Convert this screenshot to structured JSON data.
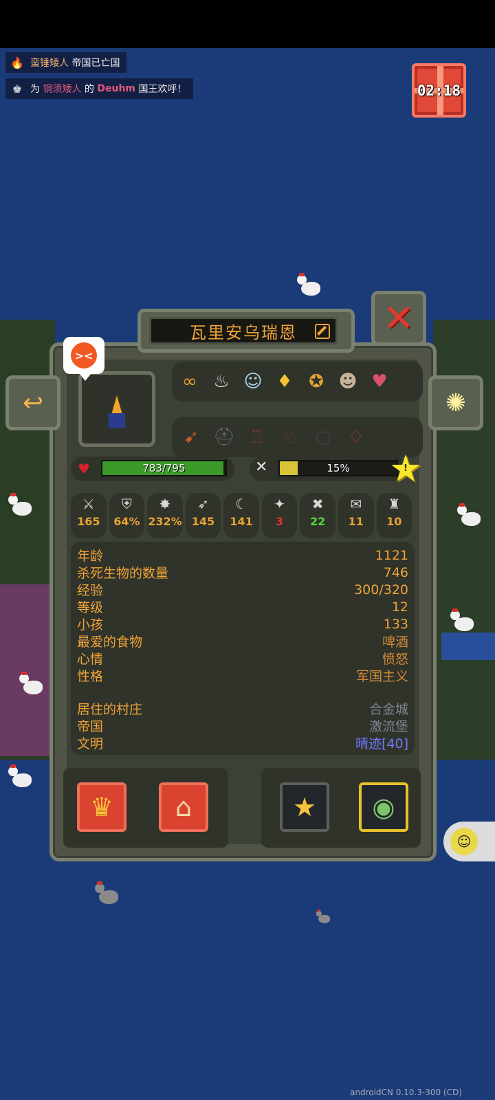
{
  "notifications": [
    {
      "icon": "fire-icon",
      "parts": [
        {
          "text": "蛮锤矮人",
          "style": "k"
        },
        {
          "text": " 帝国已亡国",
          "style": "w"
        }
      ]
    },
    {
      "icon": "king-icon",
      "parts": [
        {
          "text": "为 ",
          "style": "w"
        },
        {
          "text": "铜须矮人",
          "style": "r"
        },
        {
          "text": " 的 ",
          "style": "w"
        },
        {
          "text": "Deuhm",
          "style": "hl"
        },
        {
          "text": " 国王欢呼！",
          "style": "w"
        }
      ]
    }
  ],
  "gift_timer": "02:18",
  "unit": {
    "name": "瓦里安乌瑞恩",
    "mood_icon": "angry-face-icon",
    "traits": [
      "infinity-icon",
      "meat-icon",
      "ghost-icon",
      "golden-tooth-icon",
      "medal-icon",
      "hooded-figure-icon",
      "heart-mask-icon"
    ],
    "items": [
      "bow-icon",
      "helmet-icon",
      "armor-icon",
      "boots-icon",
      "ring-icon",
      "amulet-icon"
    ],
    "health": {
      "current": 783,
      "max": 795,
      "text": "783/795"
    },
    "hunger": {
      "percent": 15,
      "text": "15%"
    },
    "star_level": "!",
    "stats": [
      {
        "icon": "sword-icon",
        "glyph": "⚔",
        "value": "165",
        "color": "orange"
      },
      {
        "icon": "shield-icon",
        "glyph": "⛨",
        "value": "64%",
        "color": "orange"
      },
      {
        "icon": "crit-icon",
        "glyph": "✸",
        "value": "232%",
        "color": "orange"
      },
      {
        "icon": "speed-wing-icon",
        "glyph": "➶",
        "value": "145",
        "color": "orange"
      },
      {
        "icon": "scythe-icon",
        "glyph": "☾",
        "value": "141",
        "color": "orange"
      },
      {
        "icon": "range-icon",
        "glyph": "✦",
        "value": "3",
        "color": "red"
      },
      {
        "icon": "crossed-swords-icon",
        "glyph": "✖",
        "value": "22",
        "color": "green"
      },
      {
        "icon": "scroll-icon",
        "glyph": "✉",
        "value": "11",
        "color": "orange"
      },
      {
        "icon": "potion-icon",
        "glyph": "♜",
        "value": "10",
        "color": "orange"
      }
    ],
    "info": [
      {
        "label": "年龄",
        "value": "1121",
        "style": ""
      },
      {
        "label": "杀死生物的数量",
        "value": "746",
        "style": ""
      },
      {
        "label": "经验",
        "value": "300/320",
        "style": ""
      },
      {
        "label": "等级",
        "value": "12",
        "style": ""
      },
      {
        "label": "小孩",
        "value": "133",
        "style": ""
      },
      {
        "label": "最爱的食物",
        "value": "啤酒",
        "style": "food"
      },
      {
        "label": "心情",
        "value": "愤怒",
        "style": "food"
      },
      {
        "label": "性格",
        "value": "军国主义",
        "style": "food"
      }
    ],
    "info2": [
      {
        "label": "居住的村庄",
        "value": "合金城",
        "style": "dim"
      },
      {
        "label": "帝国",
        "value": "激流堡",
        "style": "dim"
      },
      {
        "label": "文明",
        "value": "晴迹[40]",
        "style": "blue"
      }
    ]
  },
  "bottom_buttons": [
    {
      "icon": "crown-icon",
      "glyph": "♛"
    },
    {
      "icon": "village-icon",
      "glyph": "⌂"
    },
    {
      "icon": "favorite-star-icon",
      "glyph": "★"
    },
    {
      "icon": "eye-follow-icon",
      "glyph": "◉"
    }
  ],
  "version": "androidCN 0.10.3-300 (CD)"
}
